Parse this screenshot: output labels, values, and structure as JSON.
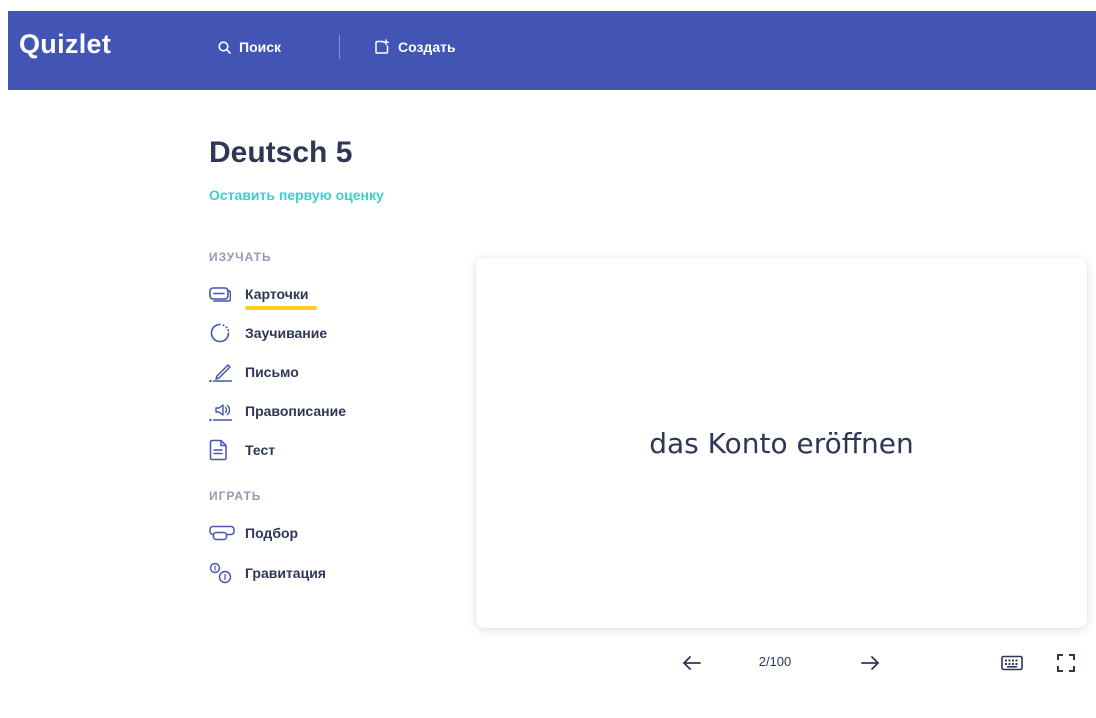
{
  "header": {
    "logo": "Quizlet",
    "search_label": "Поиск",
    "create_label": "Создать",
    "bg_color": "#4255b4"
  },
  "set": {
    "title": "Deutsch 5",
    "rate_link": "Оставить первую оценку"
  },
  "sidebar": {
    "study_heading": "ИЗУЧАТЬ",
    "study_modes": [
      {
        "label": "Карточки",
        "icon": "flashcards-icon",
        "active": true
      },
      {
        "label": "Заучивание",
        "icon": "learn-icon"
      },
      {
        "label": "Письмо",
        "icon": "write-icon"
      },
      {
        "label": "Правописание",
        "icon": "spell-icon"
      },
      {
        "label": "Тест",
        "icon": "test-icon"
      }
    ],
    "play_heading": "ИГРАТЬ",
    "play_modes": [
      {
        "label": "Подбор",
        "icon": "match-icon"
      },
      {
        "label": "Гравитация",
        "icon": "gravity-icon"
      }
    ]
  },
  "card": {
    "term": "das Konto eröffnen"
  },
  "controls": {
    "counter": "2/100",
    "accent": "#ffcd1f",
    "link_color": "#3ccfcf"
  }
}
